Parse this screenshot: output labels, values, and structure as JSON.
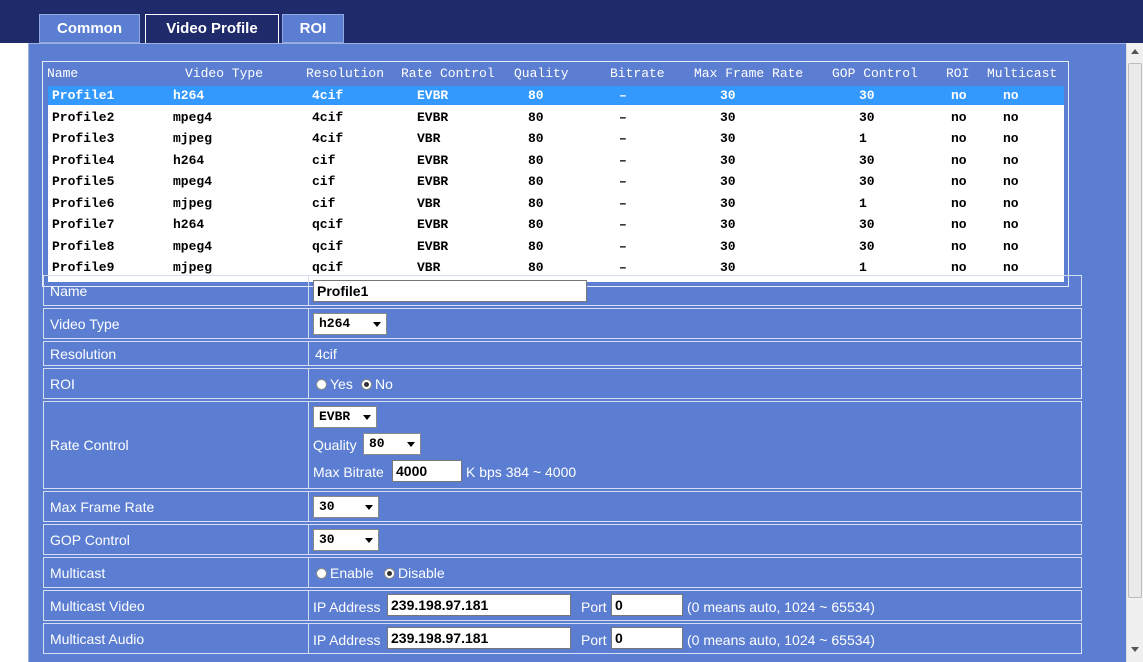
{
  "tabs": [
    {
      "label": "Common"
    },
    {
      "label": "Video Profile"
    },
    {
      "label": "ROI"
    }
  ],
  "list": {
    "headers": [
      "Name",
      "Video Type",
      "Resolution",
      "Rate Control",
      "Quality",
      "Bitrate",
      "Max Frame Rate",
      "GOP Control",
      "ROI",
      "Multicast"
    ],
    "rows": [
      [
        "Profile1",
        "h264",
        "4cif",
        "EVBR",
        "80",
        "–",
        "30",
        "30",
        "no",
        "no"
      ],
      [
        "Profile2",
        "mpeg4",
        "4cif",
        "EVBR",
        "80",
        "–",
        "30",
        "30",
        "no",
        "no"
      ],
      [
        "Profile3",
        "mjpeg",
        "4cif",
        "VBR",
        "80",
        "–",
        "30",
        "1",
        "no",
        "no"
      ],
      [
        "Profile4",
        "h264",
        "cif",
        "EVBR",
        "80",
        "–",
        "30",
        "30",
        "no",
        "no"
      ],
      [
        "Profile5",
        "mpeg4",
        "cif",
        "EVBR",
        "80",
        "–",
        "30",
        "30",
        "no",
        "no"
      ],
      [
        "Profile6",
        "mjpeg",
        "cif",
        "VBR",
        "80",
        "–",
        "30",
        "1",
        "no",
        "no"
      ],
      [
        "Profile7",
        "h264",
        "qcif",
        "EVBR",
        "80",
        "–",
        "30",
        "30",
        "no",
        "no"
      ],
      [
        "Profile8",
        "mpeg4",
        "qcif",
        "EVBR",
        "80",
        "–",
        "30",
        "30",
        "no",
        "no"
      ],
      [
        "Profile9",
        "mjpeg",
        "qcif",
        "VBR",
        "80",
        "–",
        "30",
        "1",
        "no",
        "no"
      ]
    ],
    "selected_index": 0
  },
  "form": {
    "name": {
      "label": "Name",
      "value": "Profile1"
    },
    "video_type": {
      "label": "Video Type",
      "value": "h264"
    },
    "resolution": {
      "label": "Resolution",
      "value": "4cif"
    },
    "roi": {
      "label": "ROI",
      "yes": "Yes",
      "no": "No",
      "selected": "No"
    },
    "rate_control": {
      "label": "Rate Control",
      "mode": "EVBR",
      "quality_label": "Quality",
      "quality": "80",
      "max_bitrate_label": "Max Bitrate",
      "max_bitrate": "4000",
      "bitrate_hint": "K bps 384 ~ 4000"
    },
    "max_frame_rate": {
      "label": "Max Frame Rate",
      "value": "30"
    },
    "gop_control": {
      "label": "GOP Control",
      "value": "30"
    },
    "multicast": {
      "label": "Multicast",
      "enable": "Enable",
      "disable": "Disable",
      "selected": "Disable"
    },
    "multicast_video": {
      "label": "Multicast Video",
      "ip_label": "IP Address",
      "ip": "239.198.97.181",
      "port_label": "Port",
      "port": "0",
      "hint": "(0 means auto, 1024 ~ 65534)"
    },
    "multicast_audio": {
      "label": "Multicast Audio",
      "ip_label": "IP Address",
      "ip": "239.198.97.181",
      "port_label": "Port",
      "port": "0",
      "hint": "(0 means auto, 1024 ~ 65534)"
    }
  },
  "colors": {
    "header_bg": "#1f2a6b",
    "panel_bg": "#5b7ed2",
    "selection": "#3399ff"
  }
}
